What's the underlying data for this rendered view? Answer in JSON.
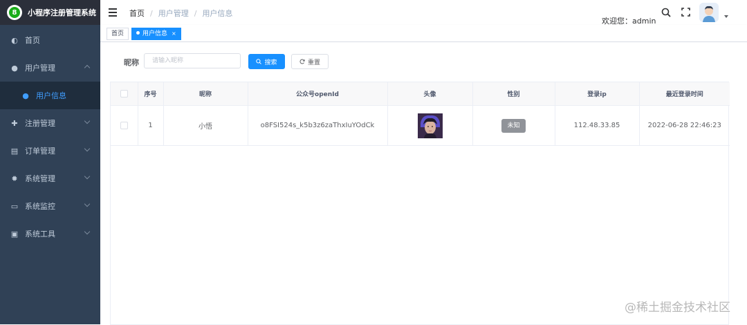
{
  "app": {
    "title": "小程序注册管理系统",
    "logo_glyph": "8"
  },
  "sidebar": {
    "items": [
      {
        "label": "首页",
        "icon": "dashboard-icon",
        "glyph": "◐",
        "chevron": ""
      },
      {
        "label": "用户管理",
        "icon": "user-icon",
        "glyph": "●",
        "chevron": "up"
      },
      {
        "label": "用户信息",
        "icon": "users-icon",
        "glyph": "●",
        "chevron": "",
        "sub": true,
        "active": true
      },
      {
        "label": "注册管理",
        "icon": "plus-circle-icon",
        "glyph": "✚",
        "chevron": "down"
      },
      {
        "label": "订单管理",
        "icon": "cart-icon",
        "glyph": "▤",
        "chevron": "down"
      },
      {
        "label": "系统管理",
        "icon": "gear-icon",
        "glyph": "✹",
        "chevron": "down"
      },
      {
        "label": "系统监控",
        "icon": "monitor-icon",
        "glyph": "▭",
        "chevron": "down"
      },
      {
        "label": "系统工具",
        "icon": "toolbox-icon",
        "glyph": "▣",
        "chevron": "down"
      }
    ]
  },
  "header": {
    "breadcrumb": [
      "首页",
      "用户管理",
      "用户信息"
    ],
    "breadcrumb_sep": "/",
    "welcome": "欢迎您：admin"
  },
  "tags": {
    "home": "首页",
    "active": "用户信息",
    "close": "×"
  },
  "search": {
    "label": "昵称",
    "placeholder": "请输入昵称",
    "value": "",
    "search_label": "搜索",
    "reset_label": "重置"
  },
  "table": {
    "columns": [
      "",
      "序号",
      "昵称",
      "公众号openId",
      "头像",
      "性别",
      "登录ip",
      "最近登录时间"
    ],
    "rows": [
      {
        "index": "1",
        "nickname": "小悟",
        "openid": "o8FSI524s_k5b3z6zaThxIuYOdCk",
        "gender": "未知",
        "ip": "112.48.33.85",
        "last_login": "2022-06-28 22:46:23"
      }
    ]
  },
  "watermark": "@稀土掘金技术社区",
  "colors": {
    "sidebar_bg": "#304156",
    "primary": "#1890ff",
    "active_menu": "#409eff"
  }
}
